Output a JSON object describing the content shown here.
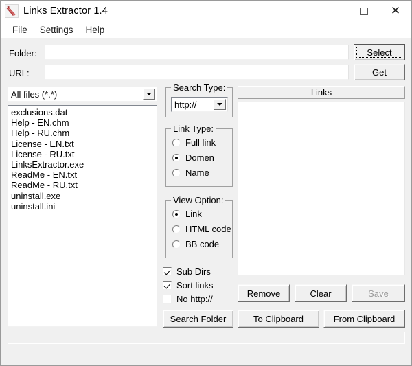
{
  "window": {
    "title": "Links Extractor 1.4",
    "icon": "links-extractor-icon",
    "controls": {
      "minimize": "minimize-icon",
      "maximize": "maximize-icon",
      "close": "close-icon"
    }
  },
  "menubar": {
    "items": [
      {
        "label": "File"
      },
      {
        "label": "Settings"
      },
      {
        "label": "Help"
      }
    ]
  },
  "form": {
    "folder_label": "Folder:",
    "folder_value": "",
    "folder_placeholder": "",
    "url_label": "URL:",
    "url_value": "",
    "url_placeholder": "",
    "select_button": "Select",
    "get_button": "Get"
  },
  "filter": {
    "selected": "All files (*.*)",
    "options": [
      "All files (*.*)"
    ]
  },
  "file_list": {
    "items": [
      "exclusions.dat",
      "Help - EN.chm",
      "Help - RU.chm",
      "License - EN.txt",
      "License - RU.txt",
      "LinksExtractor.exe",
      "ReadMe - EN.txt",
      "ReadMe - RU.txt",
      "uninstall.exe",
      "uninstall.ini"
    ]
  },
  "search_type": {
    "title": "Search Type:",
    "selected": "http://",
    "options": [
      "http://"
    ]
  },
  "link_type": {
    "title": "Link Type:",
    "options": [
      {
        "label": "Full link",
        "checked": false
      },
      {
        "label": "Domen",
        "checked": true
      },
      {
        "label": "Name",
        "checked": false
      }
    ]
  },
  "view_option": {
    "title": "View Option:",
    "options": [
      {
        "label": "Link",
        "checked": true
      },
      {
        "label": "HTML code",
        "checked": false
      },
      {
        "label": "BB code",
        "checked": false
      }
    ]
  },
  "checkboxes": [
    {
      "label": "Sub Dirs",
      "checked": true
    },
    {
      "label": "Sort links",
      "checked": true
    },
    {
      "label": "No http://",
      "checked": false
    }
  ],
  "links_panel": {
    "header": "Links",
    "items": []
  },
  "link_buttons": {
    "remove": "Remove",
    "clear": "Clear",
    "save": "Save",
    "save_disabled": true
  },
  "action_buttons": {
    "search_folder": "Search Folder",
    "to_clipboard": "To Clipboard",
    "from_clipboard": "From Clipboard"
  },
  "statusbar": {
    "text": ""
  },
  "colors": {
    "window_bg": "#f0f0f0",
    "titlebar_bg": "#ffffff",
    "field_bg": "#ffffff",
    "border": "#848484",
    "text": "#000000",
    "disabled_text": "#9a9a9a",
    "icon_accent": "#c0392b"
  }
}
